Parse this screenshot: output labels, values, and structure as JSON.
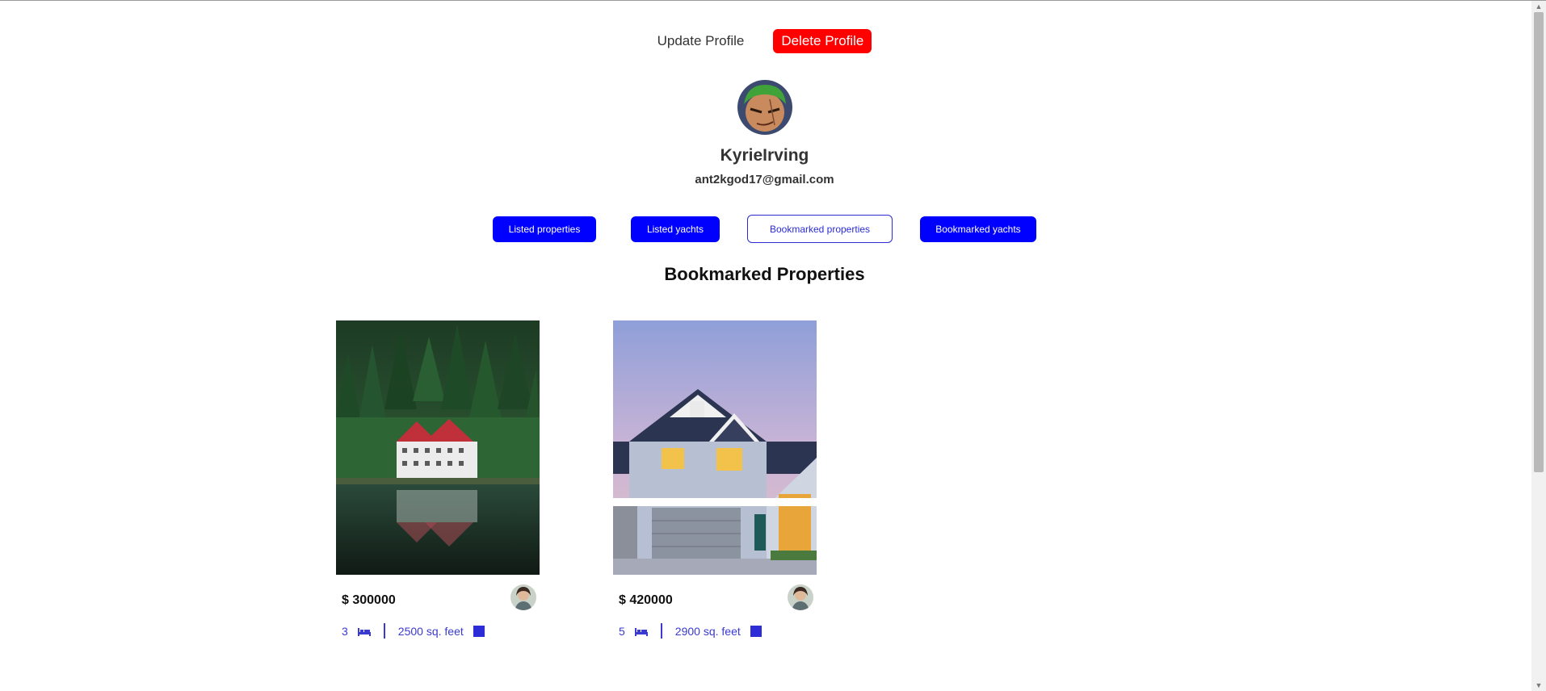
{
  "header": {
    "update_label": "Update Profile",
    "delete_label": "Delete Profile"
  },
  "profile": {
    "username": "KyrieIrving",
    "email": "ant2kgod17@gmail.com"
  },
  "tabs": [
    {
      "label": "Listed properties"
    },
    {
      "label": "Listed yachts"
    },
    {
      "label": "Bookmarked properties"
    },
    {
      "label": "Bookmarked yachts"
    }
  ],
  "active_tab": "Bookmarked properties",
  "section_title": "Bookmarked Properties",
  "cards": [
    {
      "price": "$ 300000",
      "beds": "3",
      "area": "2500 sq. feet"
    },
    {
      "price": "$ 420000",
      "beds": "5",
      "area": "2900 sq. feet"
    }
  ],
  "colors": {
    "accent": "#0000ff",
    "danger": "#ff0000",
    "spec_text": "#3a3ad0"
  },
  "icons": {
    "bed": "bed-icon",
    "area": "square-area-icon"
  }
}
